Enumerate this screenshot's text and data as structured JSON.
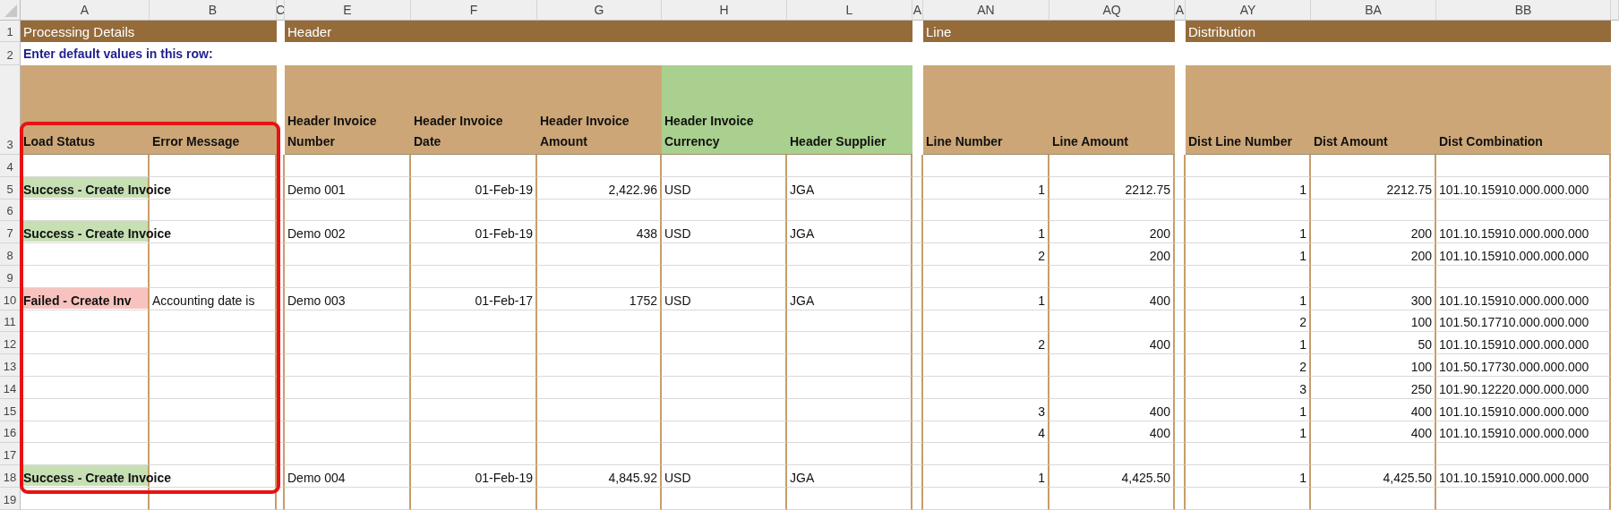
{
  "column_headers": [
    {
      "letter": "A",
      "kind": "field"
    },
    {
      "letter": "B",
      "kind": "field"
    },
    {
      "letter": "C",
      "kind": "spacer"
    },
    {
      "letter": "E",
      "kind": "field"
    },
    {
      "letter": "F",
      "kind": "field"
    },
    {
      "letter": "G",
      "kind": "field"
    },
    {
      "letter": "H",
      "kind": "field"
    },
    {
      "letter": "L",
      "kind": "field"
    },
    {
      "letter": "A",
      "kind": "spacer"
    },
    {
      "letter": "AN",
      "kind": "field"
    },
    {
      "letter": "AQ",
      "kind": "field"
    },
    {
      "letter": "A",
      "kind": "spacer"
    },
    {
      "letter": "AY",
      "kind": "field"
    },
    {
      "letter": "BA",
      "kind": "field"
    },
    {
      "letter": "BB",
      "kind": "field"
    }
  ],
  "header_row_numbers": [
    "1",
    "2",
    "3"
  ],
  "sections": [
    {
      "title": "Processing Details"
    },
    {
      "title": "Header"
    },
    {
      "title": "Line"
    },
    {
      "title": "Distribution"
    }
  ],
  "instruction": "Enter default values in this row:",
  "field_headers": [
    {
      "label": "Load Status",
      "color": "#cca677"
    },
    {
      "label": "Error Message",
      "color": "#cca677"
    },
    {
      "label": "Header Invoice Number",
      "color": "#cca677"
    },
    {
      "label": "Header Invoice Date",
      "color": "#cca677"
    },
    {
      "label": "Header Invoice Amount",
      "color": "#cca677"
    },
    {
      "label": "Header Invoice Currency",
      "color": "#a9d08e"
    },
    {
      "label": "Header Supplier",
      "color": "#a9d08e"
    },
    {
      "label": "Line Number",
      "color": "#cca677"
    },
    {
      "label": "Line Amount",
      "color": "#cca677"
    },
    {
      "label": "Dist Line Number",
      "color": "#cca677"
    },
    {
      "label": "Dist Amount",
      "color": "#cca677"
    },
    {
      "label": "Dist Combination",
      "color": "#cca677"
    }
  ],
  "rows": [
    {
      "number": "4"
    },
    {
      "number": "5",
      "load_status": {
        "text": "Success - Create Invoice",
        "color": "#c6e0b4"
      },
      "invoice_number": "Demo 001",
      "invoice_date": "01-Feb-19",
      "invoice_amount": "2,422.96",
      "currency": "USD",
      "supplier": "JGA",
      "line_number": "1",
      "line_amount": "2212.75",
      "dist_line_number": "1",
      "dist_amount": "2212.75",
      "dist_combination": "101.10.15910.000.000.000"
    },
    {
      "number": "6"
    },
    {
      "number": "7",
      "load_status": {
        "text": "Success - Create Invoice",
        "color": "#c6e0b4"
      },
      "invoice_number": "Demo 002",
      "invoice_date": "01-Feb-19",
      "invoice_amount": "438",
      "currency": "USD",
      "supplier": "JGA",
      "line_number": "1",
      "line_amount": "200",
      "dist_line_number": "1",
      "dist_amount": "200",
      "dist_combination": "101.10.15910.000.000.000"
    },
    {
      "number": "8",
      "line_number": "2",
      "line_amount": "200",
      "dist_line_number": "1",
      "dist_amount": "200",
      "dist_combination": "101.10.15910.000.000.000"
    },
    {
      "number": "9"
    },
    {
      "number": "10",
      "load_status": {
        "text": "Failed - Create Inv",
        "color": "#f8c3bf"
      },
      "error_message": "Accounting date is",
      "invoice_number": "Demo 003",
      "invoice_date": "01-Feb-17",
      "invoice_amount": "1752",
      "currency": "USD",
      "supplier": "JGA",
      "line_number": "1",
      "line_amount": "400",
      "dist_line_number": "1",
      "dist_amount": "300",
      "dist_combination": "101.10.15910.000.000.000"
    },
    {
      "number": "11",
      "dist_line_number": "2",
      "dist_amount": "100",
      "dist_combination": "101.50.17710.000.000.000"
    },
    {
      "number": "12",
      "line_number": "2",
      "line_amount": "400",
      "dist_line_number": "1",
      "dist_amount": "50",
      "dist_combination": "101.10.15910.000.000.000"
    },
    {
      "number": "13",
      "dist_line_number": "2",
      "dist_amount": "100",
      "dist_combination": "101.50.17730.000.000.000"
    },
    {
      "number": "14",
      "dist_line_number": "3",
      "dist_amount": "250",
      "dist_combination": "101.90.12220.000.000.000"
    },
    {
      "number": "15",
      "line_number": "3",
      "line_amount": "400",
      "dist_line_number": "1",
      "dist_amount": "400",
      "dist_combination": "101.10.15910.000.000.000"
    },
    {
      "number": "16",
      "line_number": "4",
      "line_amount": "400",
      "dist_line_number": "1",
      "dist_amount": "400",
      "dist_combination": "101.10.15910.000.000.000"
    },
    {
      "number": "17"
    },
    {
      "number": "18",
      "load_status": {
        "text": "Success - Create Invoice",
        "color": "#c6e0b4"
      },
      "invoice_number": "Demo 004",
      "invoice_date": "01-Feb-19",
      "invoice_amount": "4,845.92",
      "currency": "USD",
      "supplier": "JGA",
      "line_number": "1",
      "line_amount": "4,425.50",
      "dist_line_number": "1",
      "dist_amount": "4,425.50",
      "dist_combination": "101.10.15910.000.000.000"
    },
    {
      "number": "19"
    }
  ]
}
